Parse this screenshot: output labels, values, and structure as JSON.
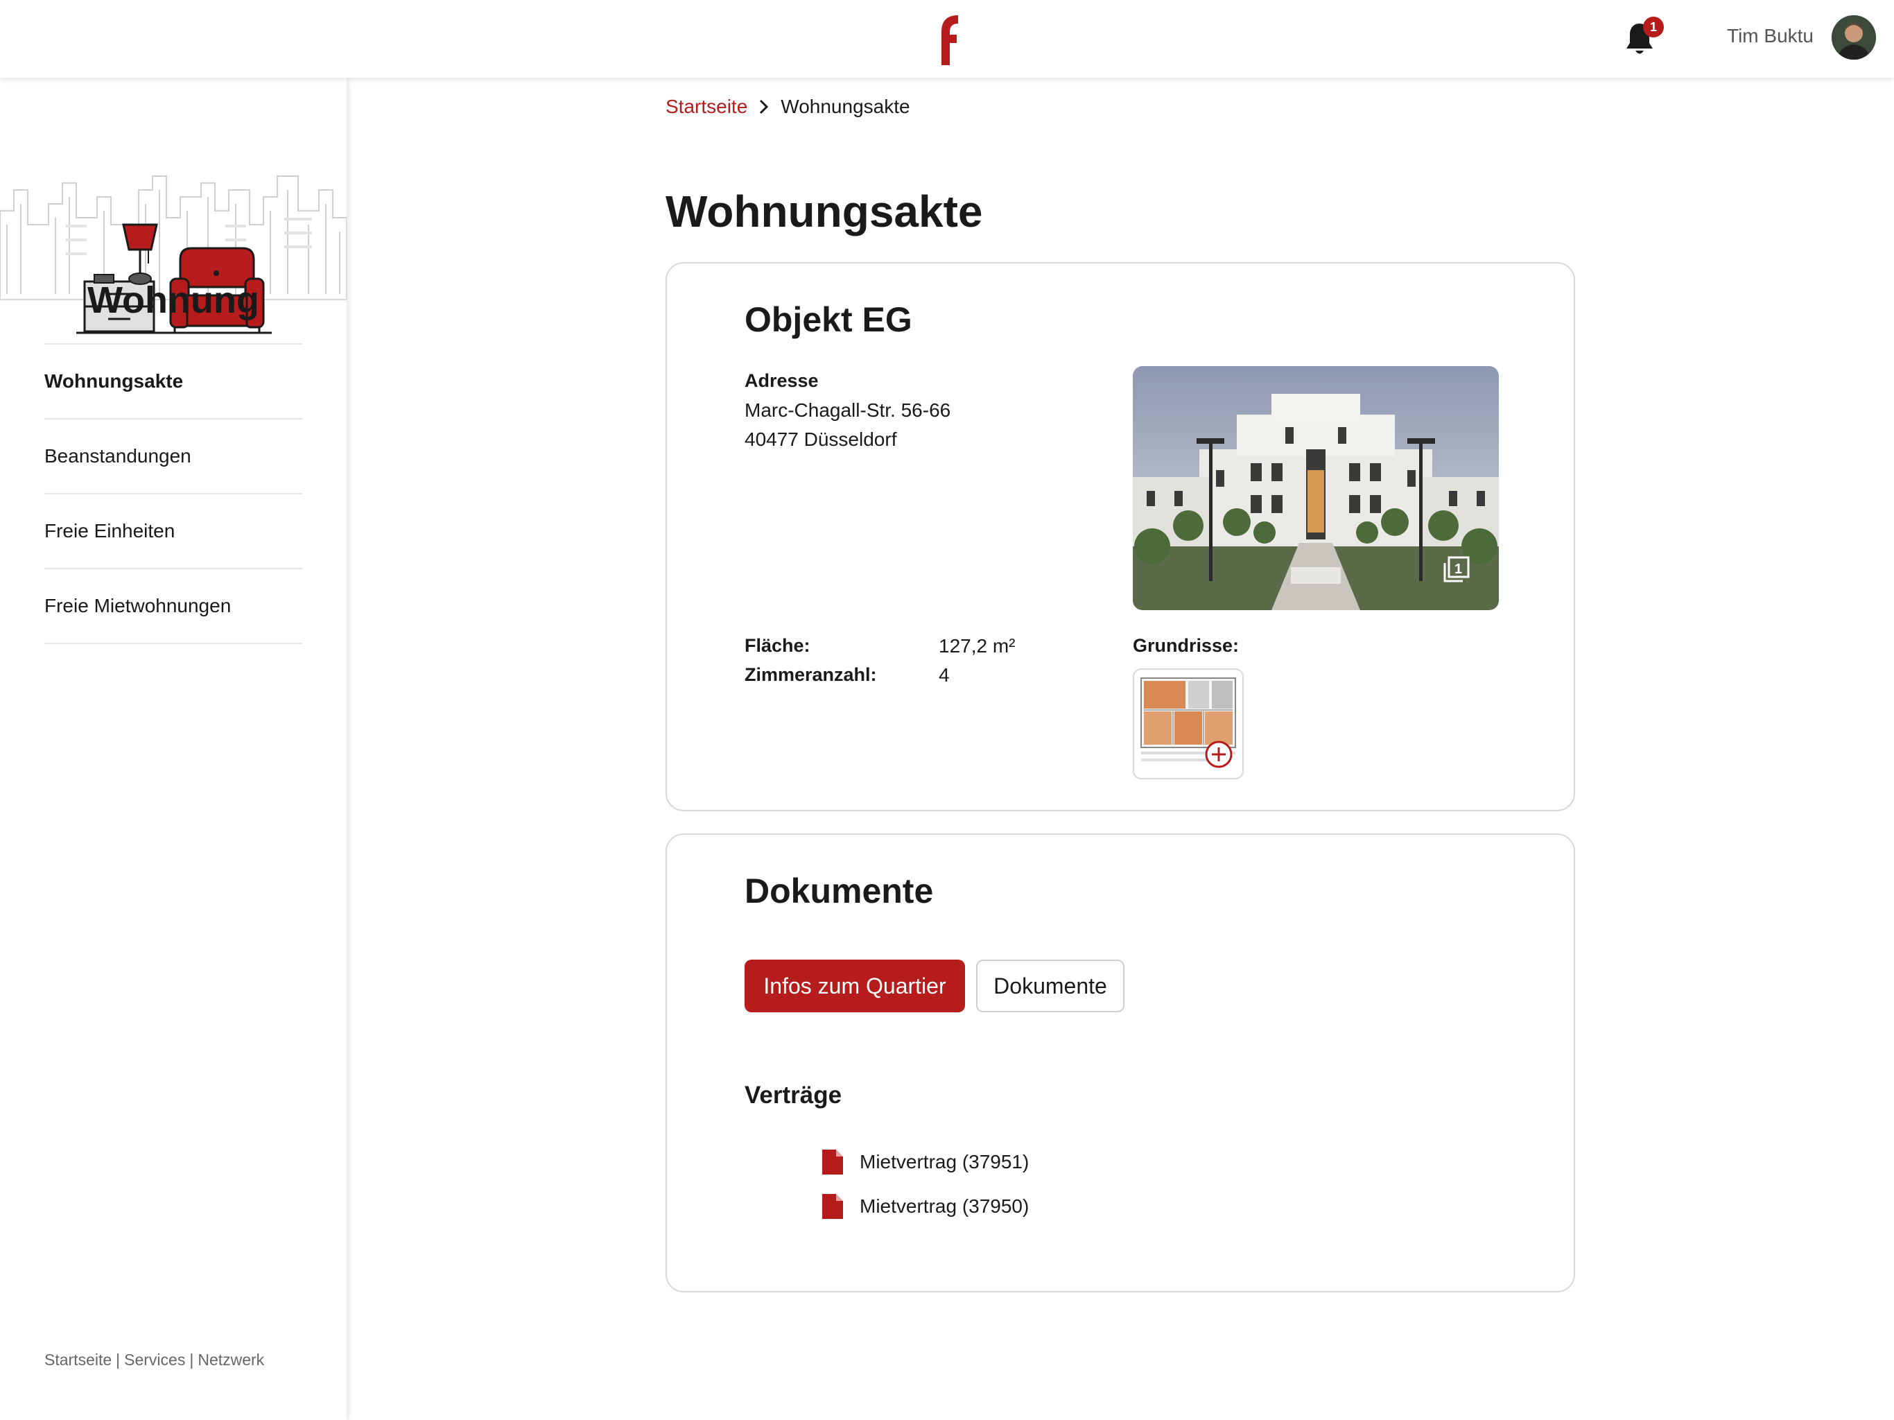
{
  "header": {
    "user_name": "Tim Buktu",
    "notification_count": "1",
    "brand_color": "#b71c1c"
  },
  "sidebar": {
    "title": "Wohnung",
    "items": [
      {
        "label": "Wohnungsakte",
        "active": true
      },
      {
        "label": "Beanstandungen",
        "active": false
      },
      {
        "label": "Freie Einheiten",
        "active": false
      },
      {
        "label": "Freie Mietwohnungen",
        "active": false
      }
    ],
    "footer": [
      "Startseite",
      "Services",
      "Netzwerk"
    ],
    "footer_separator": "|"
  },
  "breadcrumb": {
    "home": "Startseite",
    "current": "Wohnungsakte"
  },
  "page": {
    "title": "Wohnungsakte"
  },
  "object": {
    "title": "Objekt EG",
    "address_label": "Adresse",
    "address_lines": [
      "Marc-Chagall-Str. 56-66",
      "40477 Düsseldorf"
    ],
    "facts": [
      {
        "label": "Fläche:",
        "value": "127,2 m²"
      },
      {
        "label": "Zimmeranzahl:",
        "value": "4"
      }
    ],
    "floorplans_label": "Grundrisse:",
    "gallery_count": "1"
  },
  "documents": {
    "title": "Dokumente",
    "buttons": {
      "primary": "Infos zum Quartier",
      "secondary": "Dokumente"
    },
    "section_title": "Verträge",
    "files": [
      "Mietvertrag (37951)",
      "Mietvertrag (37950)"
    ]
  }
}
